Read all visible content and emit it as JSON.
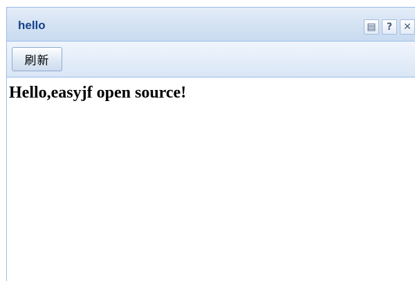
{
  "panel": {
    "title": "hello",
    "tools": [
      {
        "icon": "save-icon",
        "glyph": "▤"
      },
      {
        "icon": "help-icon",
        "glyph": "?"
      },
      {
        "icon": "close-icon",
        "glyph": "✕"
      }
    ]
  },
  "toolbar": {
    "refresh_label": "刷新"
  },
  "content": {
    "message": "Hello,easyjf open source!"
  },
  "colors": {
    "title": "#15428b",
    "border": "#99bbe8"
  }
}
